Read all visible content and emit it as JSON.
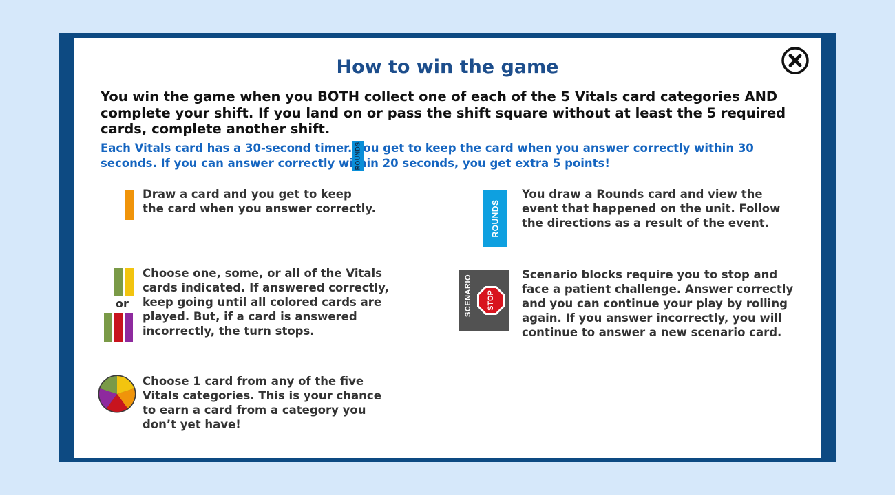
{
  "dialog": {
    "title": "How to win the game",
    "intro": "You win the game when you BOTH collect one of each of the 5 Vitals card categories AND complete your shift. If you land on or pass the shift square without at least the 5 required cards, complete another shift.",
    "timer_note": "Each Vitals card has a 30-second timer. You get to keep the card when you answer correctly within 30 seconds. If you can answer correctly within 20 seconds, you get extra 5 points!",
    "close_icon": "close-x-circle"
  },
  "rules": {
    "draw_card": "Draw a card and you get to keep the card when you answer correctly.",
    "rounds": "You draw a Rounds card and view the event that happened on the unit. Follow the directions as a result of the event.",
    "choose_cards": "Choose one, some, or all of the Vitals cards indicated. If answered correctly, keep going until all colored cards are played. But, if a card is answered incorrectly, the turn stops.",
    "scenario": "Scenario blocks require you to stop and face a patient challenge. Answer correctly and you can continue your play by rolling again. If you answer incorrectly, you will continue to answer a new scenario card.",
    "wheel": "Choose 1 card from any of the five Vitals categories. This is your chance to earn a card from a category you don’t yet have!"
  },
  "icons": {
    "rounds_label": "ROUNDS",
    "or_label": "or",
    "scenario_label": "SCENARIO",
    "stop_label": "STOP"
  },
  "colors": {
    "frame": "#0d4a82",
    "title": "#1d4e8c",
    "timer_text": "#1565c0",
    "orange": "#f0940a",
    "green": "#7a9a47",
    "yellow": "#f2c40f",
    "red": "#c8141e",
    "purple": "#8e2a9e",
    "rounds_blue": "#0ea0e0",
    "scenario_gray": "#525252"
  }
}
